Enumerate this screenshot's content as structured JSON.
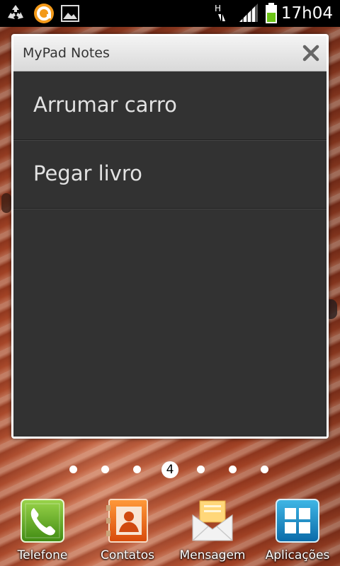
{
  "status_bar": {
    "time": "17h04",
    "network_type": "H",
    "icons": [
      "recycle-icon",
      "app-notification-icon",
      "gallery-icon",
      "data-transfer-icon",
      "signal-icon",
      "battery-icon"
    ]
  },
  "widget": {
    "title": "MyPad Notes",
    "notes": [
      {
        "label": "Arrumar carro"
      },
      {
        "label": "Pegar livro"
      }
    ]
  },
  "pager": {
    "current_page": "4",
    "page_count": 7
  },
  "dock": {
    "items": [
      {
        "label": "Telefone",
        "icon": "phone-icon"
      },
      {
        "label": "Contatos",
        "icon": "contacts-icon"
      },
      {
        "label": "Mensagem",
        "icon": "message-icon"
      },
      {
        "label": "Aplicações",
        "icon": "apps-grid-icon"
      }
    ]
  },
  "colors": {
    "widget_body": "#323232",
    "note_text": "#e2e2e2",
    "status_bar": "#000000"
  }
}
